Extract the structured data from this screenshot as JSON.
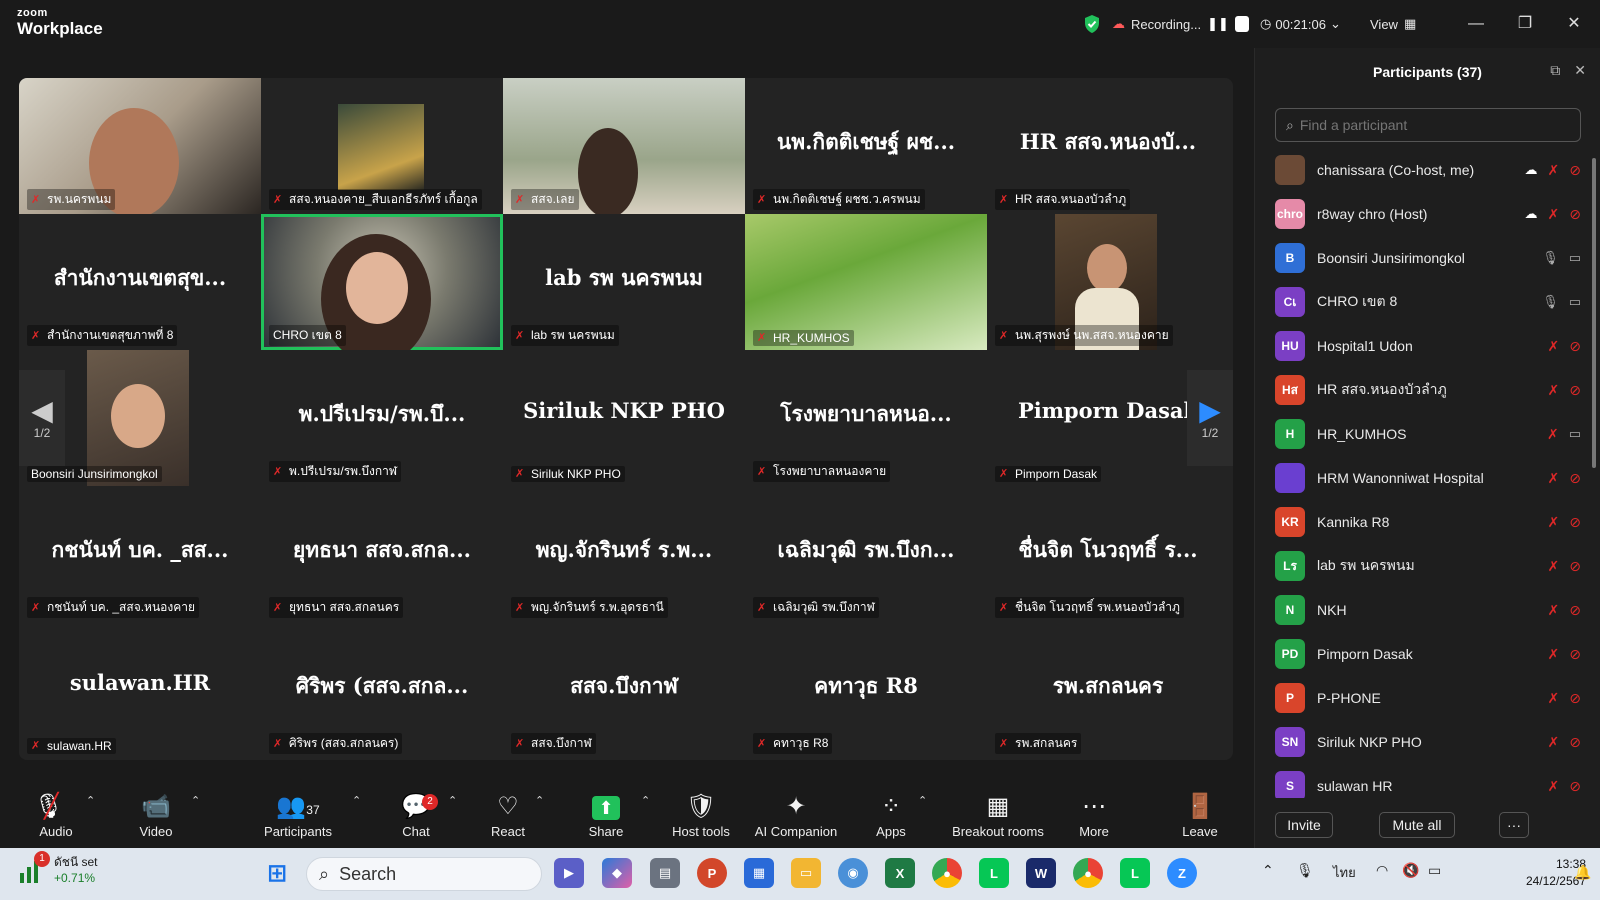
{
  "app": {
    "brand_small": "zoom",
    "brand_big": "Workplace"
  },
  "titlebar": {
    "recording_label": "Recording...",
    "timer": "00:21:06",
    "view_label": "View"
  },
  "gallery": {
    "page_left": "1/2",
    "page_right": "1/2",
    "tiles": [
      {
        "label": "รพ.นครพนม",
        "big": ""
      },
      {
        "label": "สสจ.หนองคาย_สืบเอกธีรภัทร์ เกื้อกูล",
        "big": ""
      },
      {
        "label": "สสจ.เลย",
        "big": ""
      },
      {
        "label": "นพ.กิตติเชษฐ์ ผชช.ว.ครพนม",
        "big": "นพ.กิตติเชษฐ์ ผช..."
      },
      {
        "label": "HR  สสจ.หนองบัวลำภู",
        "big": "HR  สสจ.หนองบั..."
      },
      {
        "label": "สำนักงานเขตสุขภาพที่ 8",
        "big": "สำนักงานเขตสุข..."
      },
      {
        "label": "CHRO เขต 8",
        "big": ""
      },
      {
        "label": "lab รพ นครพนม",
        "big": "lab รพ นครพนม"
      },
      {
        "label": "HR_KUMHOS",
        "big": ""
      },
      {
        "label": "นพ.สุรพงษ์ นพ.สสจ.หนองคาย",
        "big": ""
      },
      {
        "label": "Boonsiri Junsirimongkol",
        "big": ""
      },
      {
        "label": "พ.ปรีเปรม/รพ.บึงกาฬ",
        "big": "พ.ปรีเปรม/รพ.บึ..."
      },
      {
        "label": "Siriluk NKP PHO",
        "big": "Siriluk NKP PHO"
      },
      {
        "label": "โรงพยาบาลหนองคาย",
        "big": "โรงพยาบาลหนอ..."
      },
      {
        "label": "Pimporn Dasak",
        "big": "Pimporn Dasak"
      },
      {
        "label": "กชนันท์ บค. _สสจ.หนองคาย",
        "big": "กชนันท์ บค. _สส..."
      },
      {
        "label": "ยุทธนา  สสจ.สกลนคร",
        "big": "ยุทธนา  สสจ.สกล..."
      },
      {
        "label": "พญ.จักรินทร์ ร.พ.อุดรธานี",
        "big": "พญ.จักรินทร์ ร.พ..."
      },
      {
        "label": "เฉลิมวุฒิ รพ.บึงกาฬ",
        "big": "เฉลิมวุฒิ รพ.บึงก..."
      },
      {
        "label": "ชื่นจิต โนวฤทธิ์ รพ.หนองบัวลำภู",
        "big": "ชื่นจิต โนวฤทธิ์ ร..."
      },
      {
        "label": "sulawan.HR",
        "big": "sulawan.HR"
      },
      {
        "label": "ศิริพร (สสจ.สกลนคร)",
        "big": "ศิริพร (สสจ.สกล..."
      },
      {
        "label": "สสจ.บึงกาฬ",
        "big": "สสจ.บึงกาฬ"
      },
      {
        "label": "คทาวุธ R8",
        "big": "คทาวุธ R8"
      },
      {
        "label": "รพ.สกลนคร",
        "big": "รพ.สกลนคร"
      }
    ]
  },
  "participants": {
    "title": "Participants (37)",
    "search_placeholder": "Find a participant",
    "invite_label": "Invite",
    "mute_all_label": "Mute all",
    "more_label": "···",
    "list": [
      {
        "initials": "",
        "name": "chanissara (Co-host, me)",
        "color": "#6b4a36",
        "cloud": true,
        "muted": true,
        "video_off": true
      },
      {
        "initials": "chro",
        "name": "r8way chro (Host)",
        "color": "#e58aa8",
        "cloud": true,
        "muted": true,
        "video_off": true
      },
      {
        "initials": "B",
        "name": "Boonsiri Junsirimongkol",
        "color": "#2f6fd6",
        "cloud": false,
        "muted": false,
        "video_off": false
      },
      {
        "initials": "Cเ",
        "name": "CHRO เขต 8",
        "color": "#7b3fc4",
        "cloud": false,
        "muted": false,
        "video_off": false
      },
      {
        "initials": "HU",
        "name": "Hospital1 Udon",
        "color": "#7b3fc4",
        "cloud": false,
        "muted": true,
        "video_off": true
      },
      {
        "initials": "Hส",
        "name": "HR  สสจ.หนองบัวลำภู",
        "color": "#d9452b",
        "cloud": false,
        "muted": true,
        "video_off": true
      },
      {
        "initials": "H",
        "name": "HR_KUMHOS",
        "color": "#24a148",
        "cloud": false,
        "muted": true,
        "video_off": false
      },
      {
        "initials": "",
        "name": "HRM Wanonniwat Hospital",
        "color": "#6a3fd0",
        "cloud": false,
        "muted": true,
        "video_off": true
      },
      {
        "initials": "KR",
        "name": "Kannika R8",
        "color": "#d9452b",
        "cloud": false,
        "muted": true,
        "video_off": true
      },
      {
        "initials": "Lร",
        "name": "lab รพ นครพนม",
        "color": "#24a148",
        "cloud": false,
        "muted": true,
        "video_off": true
      },
      {
        "initials": "N",
        "name": "NKH",
        "color": "#24a148",
        "cloud": false,
        "muted": true,
        "video_off": true
      },
      {
        "initials": "PD",
        "name": "Pimporn Dasak",
        "color": "#24a148",
        "cloud": false,
        "muted": true,
        "video_off": true
      },
      {
        "initials": "P",
        "name": "P-PHONE",
        "color": "#d9452b",
        "cloud": false,
        "muted": true,
        "video_off": true
      },
      {
        "initials": "SN",
        "name": "Siriluk NKP PHO",
        "color": "#7b3fc4",
        "cloud": false,
        "muted": true,
        "video_off": true
      },
      {
        "initials": "S",
        "name": "sulawan HR",
        "color": "#7b3fc4",
        "cloud": false,
        "muted": true,
        "video_off": true
      }
    ]
  },
  "toolbar": {
    "audio": "Audio",
    "video": "Video",
    "participants": "Participants",
    "participants_count": "37",
    "chat": "Chat",
    "chat_badge": "2",
    "react": "React",
    "share": "Share",
    "host_tools": "Host tools",
    "ai_companion": "AI Companion",
    "apps": "Apps",
    "breakout": "Breakout rooms",
    "more": "More",
    "leave": "Leave"
  },
  "taskbar": {
    "weather_title": "ดัชนี set",
    "weather_change": "+0.71%",
    "weather_badge": "1",
    "search_label": "Search",
    "lang": "ไทย",
    "time": "13:38",
    "date": "24/12/2567"
  }
}
